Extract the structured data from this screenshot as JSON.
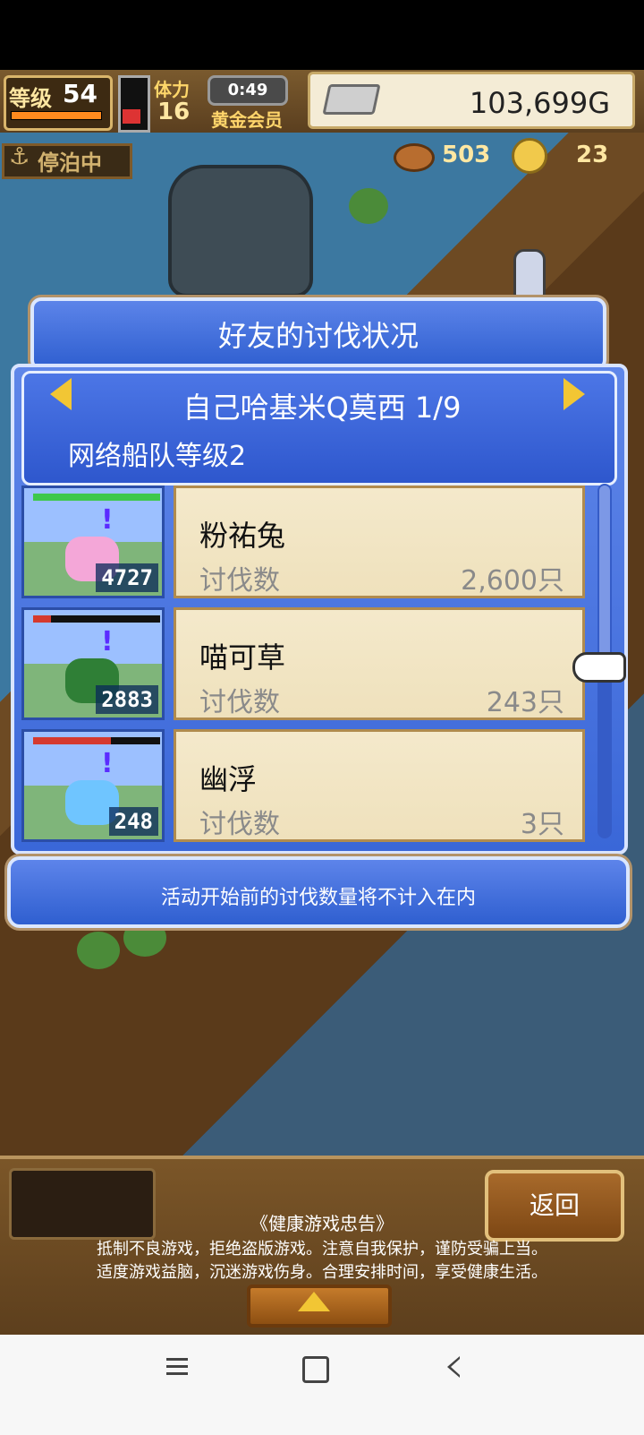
{
  "hud": {
    "level_label": "等级",
    "level_value": "54",
    "tree_label": "体力",
    "tree_value": "16",
    "timer": "0:49",
    "member_label": "黄金会员",
    "money": "103,699G",
    "status_label": "停泊中",
    "food_value": "503",
    "coin_value": "23"
  },
  "panel": {
    "title": "好友的讨伐状况",
    "friend_name": "自己哈基米Q莫西 1/9",
    "friend_level": "网络船队等级2",
    "notice": "活动开始前的讨伐数量将不计入在内"
  },
  "list": [
    {
      "name": "粉祐兔",
      "kill_label": "讨伐数",
      "kills": "2,600只",
      "count": "4727",
      "hp_fraction": 1.0,
      "color": "#f4a7d8"
    },
    {
      "name": "喵可草",
      "kill_label": "讨伐数",
      "kills": "243只",
      "count": "2883",
      "hp_fraction": 0.14,
      "color": "#2f7f36"
    },
    {
      "name": "幽浮",
      "kill_label": "讨伐数",
      "kills": "3只",
      "count": "248",
      "hp_fraction": 0.61,
      "color": "#6fc5ff"
    }
  ],
  "footer": {
    "back_label": "返回",
    "warning_title": "《健康游戏忠告》",
    "warning_line1": "抵制不良游戏，拒绝盗版游戏。注意自我保护，谨防受骗上当。",
    "warning_line2": "适度游戏益脑，沉迷游戏伤身。合理安排时间，享受健康生活。"
  },
  "icons": {
    "anchor": "anchor-icon",
    "money": "silver-bar-icon",
    "food": "meat-icon",
    "coin": "coin-icon",
    "prev": "left-arrow-icon",
    "next": "right-arrow-icon",
    "pointer": "hand-pointer-icon",
    "expand": "up-triangle-icon"
  }
}
